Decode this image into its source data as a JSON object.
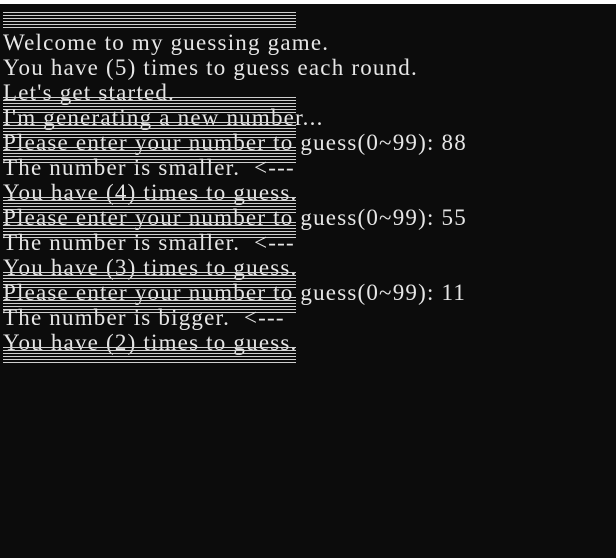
{
  "console": {
    "lines": [
      {
        "type": "sep"
      },
      {
        "type": "text",
        "text": "Welcome to my guessing game."
      },
      {
        "type": "text",
        "text": "You have (5) times to guess each round."
      },
      {
        "type": "text",
        "text": "Let's get started."
      },
      {
        "type": "sep"
      },
      {
        "type": "text",
        "text": "I'm generating a new number..."
      },
      {
        "type": "sep"
      },
      {
        "type": "text",
        "text": "Please enter your number to guess(0~99): 88"
      },
      {
        "type": "sep"
      },
      {
        "type": "text",
        "text": "The number is smaller.  <---"
      },
      {
        "type": "text",
        "text": "You have (4) times to guess."
      },
      {
        "type": "sep"
      },
      {
        "type": "text",
        "text": "Please enter your number to guess(0~99): 55"
      },
      {
        "type": "sep"
      },
      {
        "type": "text",
        "text": "The number is smaller.  <---"
      },
      {
        "type": "text",
        "text": "You have (3) times to guess."
      },
      {
        "type": "sep"
      },
      {
        "type": "text",
        "text": "Please enter your number to guess(0~99): 11"
      },
      {
        "type": "sep"
      },
      {
        "type": "text",
        "text": "The number is bigger.  <---"
      },
      {
        "type": "text",
        "text": "You have (2) times to guess."
      },
      {
        "type": "sep"
      }
    ]
  }
}
